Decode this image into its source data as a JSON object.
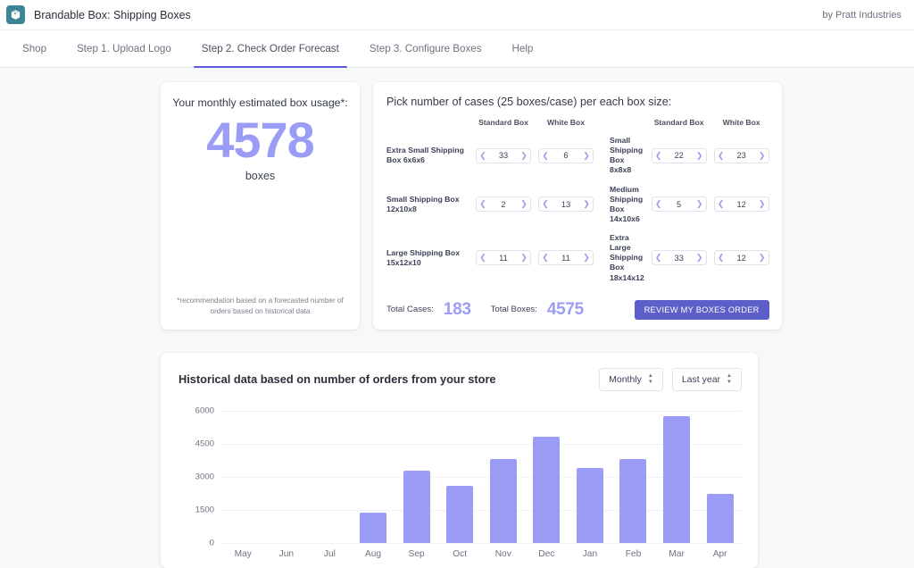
{
  "topbar": {
    "logo_icon": "box-cube-icon",
    "app_title": "Brandable Box: Shipping Boxes",
    "vendor": "by Pratt Industries",
    "logo_color": "#3d8496"
  },
  "nav": {
    "items": [
      {
        "label": "Shop",
        "active": false
      },
      {
        "label": "Step 1. Upload Logo",
        "active": false
      },
      {
        "label": "Step 2. Check Order Forecast",
        "active": true
      },
      {
        "label": "Step 3. Configure Boxes",
        "active": false
      },
      {
        "label": "Help",
        "active": false
      }
    ],
    "active_underline_color": "#5c5ce0"
  },
  "usage": {
    "title": "Your monthly estimated box usage*:",
    "number": "4578",
    "unit": "boxes",
    "note": "*recommendation based on a forecasted number of orders based on historical data",
    "accent_color": "#9b9cf5"
  },
  "picker": {
    "title": "Pick number of cases (25 boxes/case) per each box size:",
    "col_headers": [
      "Standard Box",
      "White Box",
      "Standard Box",
      "White Box"
    ],
    "left_rows": [
      {
        "label": "Extra Small Shipping Box 6x6x6",
        "standard": "33",
        "white": "6"
      },
      {
        "label": "Small Shipping Box 12x10x8",
        "standard": "2",
        "white": "13"
      },
      {
        "label": "Large Shipping Box 15x12x10",
        "standard": "11",
        "white": "11"
      }
    ],
    "right_rows": [
      {
        "label": "Small Shipping Box 8x8x8",
        "standard": "22",
        "white": "23"
      },
      {
        "label": "Medium Shipping Box 14x10x6",
        "standard": "5",
        "white": "12"
      },
      {
        "label": "Extra Large Shipping Box 18x14x12",
        "standard": "33",
        "white": "12"
      }
    ],
    "dec_icon": "chevron-left-icon",
    "inc_icon": "chevron-right-icon",
    "total_cases_label": "Total Cases:",
    "total_cases_value": "183",
    "total_boxes_label": "Total Boxes:",
    "total_boxes_value": "4575",
    "review_button": "REVIEW MY BOXES ORDER",
    "review_button_color": "#5b5fc7"
  },
  "chart_section": {
    "title": "Historical data based on number of orders from your store",
    "period_select": "Monthly",
    "range_select": "Last year",
    "select_icon": "up-down-caret-icon"
  },
  "chart_data": {
    "type": "bar",
    "title": "Historical data based on number of orders from your store",
    "xlabel": "",
    "ylabel": "",
    "categories": [
      "May",
      "Jun",
      "Jul",
      "Aug",
      "Sep",
      "Oct",
      "Nov",
      "Dec",
      "Jan",
      "Feb",
      "Mar",
      "Apr"
    ],
    "values": [
      0,
      0,
      0,
      1350,
      3250,
      2570,
      3800,
      4830,
      3400,
      3780,
      5760,
      2200
    ],
    "ylim": [
      0,
      6000
    ],
    "yticks": [
      0,
      1500,
      3000,
      4500,
      6000
    ],
    "ytick_labels": [
      "0",
      "1500",
      "3000",
      "4500",
      "6000"
    ],
    "grid": true,
    "legend": false,
    "bar_color": "#9b9cf5"
  }
}
